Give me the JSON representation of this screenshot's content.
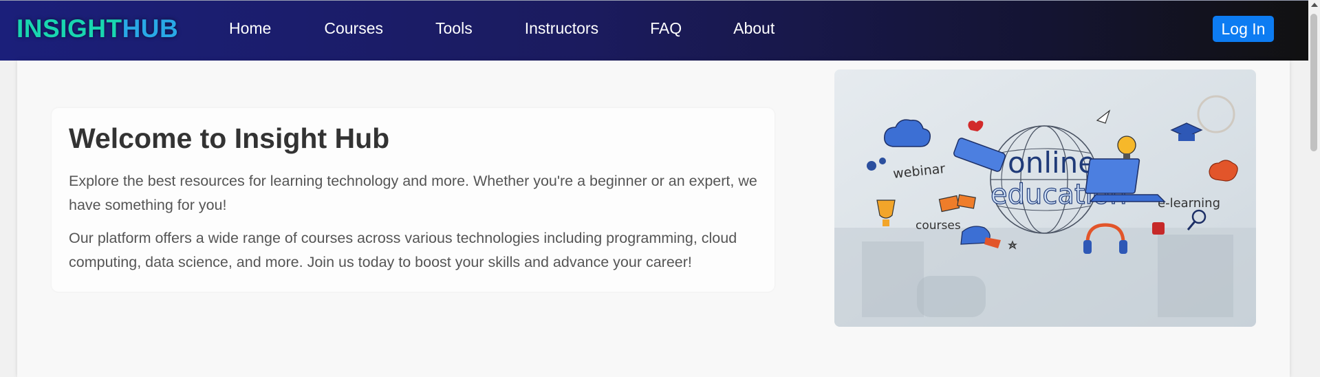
{
  "nav": {
    "logo_part1": "INSIGHT",
    "logo_part2": "HUB",
    "links": [
      "Home",
      "Courses",
      "Tools",
      "Instructors",
      "FAQ",
      "About"
    ],
    "login_label": "Log In"
  },
  "hero": {
    "title": "Welcome to Insight Hub",
    "paragraph1": "Explore the best resources for learning technology and more. Whether you're a beginner or an expert, we have something for you!",
    "paragraph2": "Our platform offers a wide range of courses across various technologies including programming, cloud computing, data science, and more. Join us today to boost your skills and advance your career!"
  },
  "image": {
    "word_online": "online",
    "word_education": "education",
    "word_webinar": "webinar",
    "word_courses": "courses",
    "word_elearning": "e-learning"
  },
  "colors": {
    "logo_teal": "#19d6b0",
    "logo_blue": "#29a8e6",
    "login_button": "#0d7cf2",
    "nav_start": "#1b1f7a",
    "nav_end": "#111111"
  }
}
